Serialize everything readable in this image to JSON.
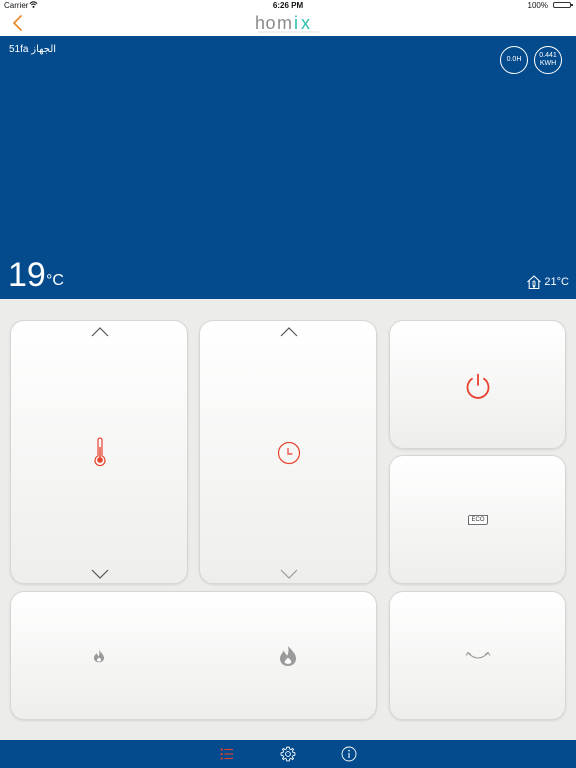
{
  "status_bar": {
    "carrier": "Carrier",
    "time": "6:26 PM",
    "battery": "100%"
  },
  "nav": {
    "back_icon": "chevron-left-icon",
    "logo_text": "homix"
  },
  "device": {
    "name": "51fa الجهاز",
    "hours_badge": "0.0H",
    "energy_value": "0.441",
    "energy_unit": "KWH",
    "temperature": "19",
    "temperature_unit": "°C",
    "outdoor_temperature": "21°C"
  },
  "controls": {
    "eco_label": "ECO"
  },
  "colors": {
    "header_blue": "#044b8d",
    "accent_red": "#e8412d",
    "accent_orange": "#e98a2e",
    "logo_gray": "#8c8c8c",
    "logo_teal": "#2bbfaf",
    "icon_gray": "#9a9a9a"
  },
  "tabbar": {
    "items": [
      "list-icon",
      "settings-icon",
      "info-icon"
    ]
  }
}
